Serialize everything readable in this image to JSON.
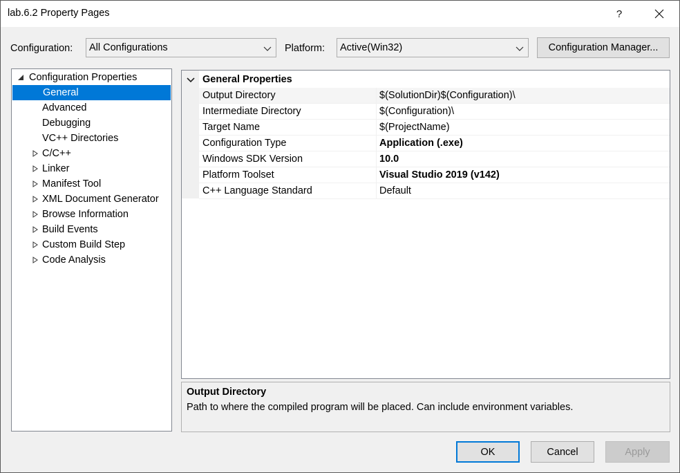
{
  "window": {
    "title": "lab.6.2 Property Pages",
    "help_label": "?",
    "close_label": "✕"
  },
  "config_bar": {
    "configuration_label": "Configuration:",
    "configuration_value": "All Configurations",
    "platform_label": "Platform:",
    "platform_value": "Active(Win32)",
    "config_manager_label": "Configuration Manager..."
  },
  "tree": {
    "root": "Configuration Properties",
    "items": [
      {
        "label": "General",
        "selected": true,
        "expandable": false
      },
      {
        "label": "Advanced",
        "expandable": false
      },
      {
        "label": "Debugging",
        "expandable": false
      },
      {
        "label": "VC++ Directories",
        "expandable": false
      },
      {
        "label": "C/C++",
        "expandable": true
      },
      {
        "label": "Linker",
        "expandable": true
      },
      {
        "label": "Manifest Tool",
        "expandable": true
      },
      {
        "label": "XML Document Generator",
        "expandable": true
      },
      {
        "label": "Browse Information",
        "expandable": true
      },
      {
        "label": "Build Events",
        "expandable": true
      },
      {
        "label": "Custom Build Step",
        "expandable": true
      },
      {
        "label": "Code Analysis",
        "expandable": true
      }
    ]
  },
  "grid": {
    "category": "General Properties",
    "rows": [
      {
        "name": "Output Directory",
        "value": "$(SolutionDir)$(Configuration)\\",
        "bold": false
      },
      {
        "name": "Intermediate Directory",
        "value": "$(Configuration)\\",
        "bold": false
      },
      {
        "name": "Target Name",
        "value": "$(ProjectName)",
        "bold": false
      },
      {
        "name": "Configuration Type",
        "value": "Application (.exe)",
        "bold": true
      },
      {
        "name": "Windows SDK Version",
        "value": "10.0",
        "bold": true
      },
      {
        "name": "Platform Toolset",
        "value": "Visual Studio 2019 (v142)",
        "bold": true
      },
      {
        "name": "C++ Language Standard",
        "value": "Default",
        "bold": false
      }
    ]
  },
  "description": {
    "title": "Output Directory",
    "text": "Path to where the compiled program will be placed. Can include environment variables."
  },
  "buttons": {
    "ok": "OK",
    "cancel": "Cancel",
    "apply": "Apply"
  },
  "colors": {
    "selection": "#0078d7",
    "window_bg": "#f0f0f0",
    "titlebar_bg": "#ffffff"
  }
}
